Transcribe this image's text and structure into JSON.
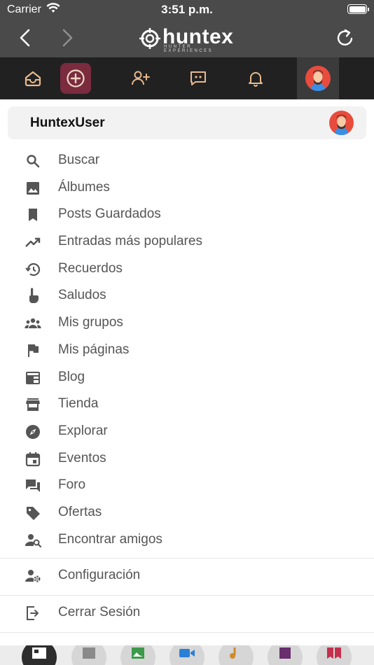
{
  "status_bar": {
    "carrier": "Carrier",
    "time": "3:51 p.m."
  },
  "header": {
    "brand": "huntex",
    "tagline": "HUNTER EXPERIENCES"
  },
  "profile": {
    "username": "HuntexUser"
  },
  "menu": {
    "items": [
      {
        "label": "Buscar",
        "icon": "search-icon"
      },
      {
        "label": "Álbumes",
        "icon": "image-icon"
      },
      {
        "label": "Posts Guardados",
        "icon": "bookmark-icon"
      },
      {
        "label": "Entradas más populares",
        "icon": "trending-icon"
      },
      {
        "label": "Recuerdos",
        "icon": "history-icon"
      },
      {
        "label": "Saludos",
        "icon": "poke-icon"
      },
      {
        "label": "Mis grupos",
        "icon": "groups-icon"
      },
      {
        "label": "Mis páginas",
        "icon": "flag-icon"
      },
      {
        "label": "Blog",
        "icon": "blog-icon"
      },
      {
        "label": "Tienda",
        "icon": "store-icon"
      },
      {
        "label": "Explorar",
        "icon": "compass-icon"
      },
      {
        "label": "Eventos",
        "icon": "calendar-icon"
      },
      {
        "label": "Foro",
        "icon": "forum-icon"
      },
      {
        "label": "Ofertas",
        "icon": "tag-icon"
      },
      {
        "label": "Encontrar amigos",
        "icon": "find-friends-icon"
      }
    ],
    "settings_label": "Configuración",
    "logout_label": "Cerrar Sesión"
  },
  "colors": {
    "header_bg": "#4a4a4a",
    "toolbar_bg": "#212121",
    "accent": "#7a2b3e",
    "toolbar_icon": "#e8b98e",
    "menu_icon": "#555555"
  }
}
